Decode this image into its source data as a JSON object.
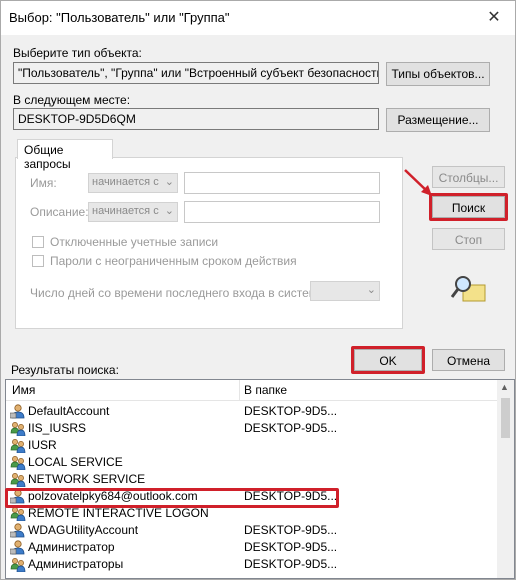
{
  "window": {
    "title": "Выбор: \"Пользователь\" или \"Группа\"",
    "close_glyph": "✕"
  },
  "object_type": {
    "label": "Выберите тип объекта:",
    "value": "\"Пользователь\", \"Группа\" или \"Встроенный субъект безопасности\"",
    "button": "Типы объектов..."
  },
  "location": {
    "label": "В следующем месте:",
    "value": "DESKTOP-9D5D6QM",
    "button": "Размещение..."
  },
  "common_queries": {
    "tab": "Общие запросы",
    "name_label": "Имя:",
    "name_combo": "начинается с",
    "desc_label": "Описание:",
    "desc_combo": "начинается с",
    "disabled_accounts": "Отключенные учетные записи",
    "no_expire_passwords": "Пароли с неограниченным сроком действия",
    "days_since_logon": "Число дней со времени последнего входа в систему:"
  },
  "side_buttons": {
    "columns": "Столбцы...",
    "search": "Поиск",
    "stop": "Стоп"
  },
  "ok": "OK",
  "cancel": "Отмена",
  "results": {
    "label": "Результаты поиска:",
    "col_name": "Имя",
    "col_folder": "В папке",
    "rows": [
      {
        "name": "DefaultAccount",
        "folder": "DESKTOP-9D5...",
        "icon": "user-icon"
      },
      {
        "name": "IIS_IUSRS",
        "folder": "DESKTOP-9D5...",
        "icon": "group-icon"
      },
      {
        "name": "IUSR",
        "folder": "",
        "icon": "group-icon"
      },
      {
        "name": "LOCAL SERVICE",
        "folder": "",
        "icon": "group-icon"
      },
      {
        "name": "NETWORK SERVICE",
        "folder": "",
        "icon": "group-icon"
      },
      {
        "name": "polzovatelpky684@outlook.com",
        "folder": "DESKTOP-9D5...",
        "icon": "user-icon"
      },
      {
        "name": "REMOTE INTERACTIVE LOGON",
        "folder": "",
        "icon": "group-icon"
      },
      {
        "name": "WDAGUtilityAccount",
        "folder": "DESKTOP-9D5...",
        "icon": "user-icon"
      },
      {
        "name": "Администратор",
        "folder": "DESKTOP-9D5...",
        "icon": "user-icon"
      },
      {
        "name": "Администраторы",
        "folder": "DESKTOP-9D5...",
        "icon": "group-icon"
      }
    ]
  },
  "colors": {
    "highlight": "#d0202a"
  }
}
